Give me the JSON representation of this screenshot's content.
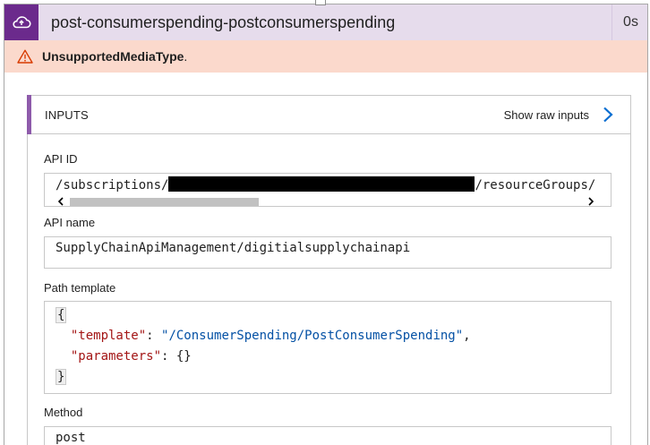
{
  "action": {
    "title": "post-consumerspending-postconsumerspending",
    "duration": "0s",
    "icon": "cloud-api-icon"
  },
  "error": {
    "icon": "warning-icon",
    "code": "UnsupportedMediaType",
    "suffix": "."
  },
  "inputs": {
    "section_title": "INPUTS",
    "show_raw_label": "Show raw inputs",
    "fields": {
      "api_id": {
        "label": "API ID",
        "value_prefix": "/subscriptions/",
        "value_suffix": "/resourceGroups/"
      },
      "api_name": {
        "label": "API name",
        "value": "SupplyChainApiManagement/digitialsupplychainapi"
      },
      "path_template": {
        "label": "Path template",
        "open_brace": "{",
        "close_brace": "}",
        "template_key": "\"template\"",
        "template_value": "\"/ConsumerSpending/PostConsumerSpending\"",
        "parameters_key": "\"parameters\"",
        "parameters_value": "{}"
      },
      "method": {
        "label": "Method",
        "value": "post"
      }
    }
  },
  "colors": {
    "header_bg": "#e6dcec",
    "icon_bg": "#6b2a8c",
    "error_bg": "#fbd9cc",
    "accent": "#8e5bab",
    "link_blue": "#0a6ed1"
  }
}
